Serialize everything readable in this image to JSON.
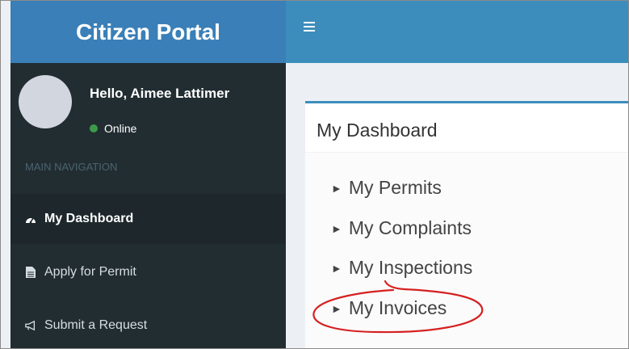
{
  "app": {
    "title": "Citizen Portal"
  },
  "user": {
    "greeting": "Hello, Aimee Lattimer",
    "status": "Online"
  },
  "sidebar": {
    "header": "MAIN NAVIGATION",
    "items": [
      {
        "label": "My Dashboard",
        "icon": "dashboard-icon",
        "active": true
      },
      {
        "label": "Apply for Permit",
        "icon": "document-icon",
        "active": false
      },
      {
        "label": "Submit a Request",
        "icon": "megaphone-icon",
        "active": false
      }
    ]
  },
  "main": {
    "box_title": "My Dashboard",
    "links": [
      "My Permits",
      "My Complaints",
      "My Inspections",
      "My Invoices"
    ]
  },
  "colors": {
    "header_blue": "#3c8dbc",
    "logo_blue": "#3a7fb8",
    "sidebar_dark": "#222d32",
    "online_green": "#3c9a4a",
    "annotation_red": "#d62020"
  }
}
